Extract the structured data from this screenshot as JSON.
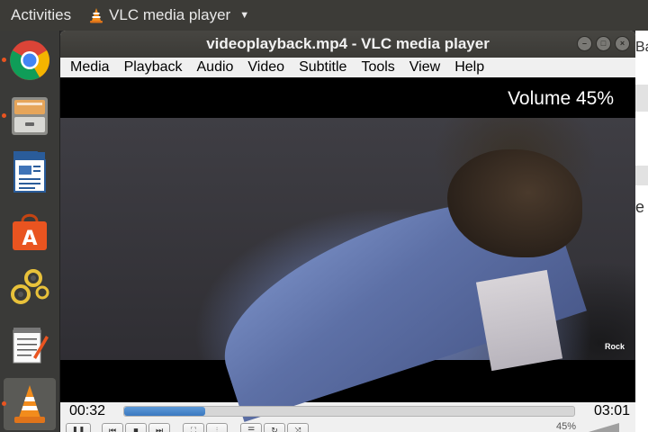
{
  "topbar": {
    "activities": "Activities",
    "app_name": "VLC media player",
    "app_icon": "vlc-cone-icon",
    "caret_icon": "caret-down-icon"
  },
  "dock": {
    "items": [
      {
        "name": "chrome",
        "icon": "chrome-icon",
        "running": true
      },
      {
        "name": "files",
        "icon": "file-cabinet-icon",
        "running": true
      },
      {
        "name": "writer",
        "icon": "document-writer-icon",
        "running": false
      },
      {
        "name": "software",
        "icon": "shopping-bag-icon",
        "running": false
      },
      {
        "name": "settings",
        "icon": "gears-icon",
        "running": false
      },
      {
        "name": "text-editor",
        "icon": "notepad-pencil-icon",
        "running": false
      },
      {
        "name": "vlc",
        "icon": "vlc-cone-icon",
        "running": true,
        "active": true
      }
    ]
  },
  "background_window": {
    "fragment_1": "Ba",
    "fragment_2": "e"
  },
  "vlc": {
    "title": "videoplayback.mp4 - VLC media player",
    "menu": [
      "Media",
      "Playback",
      "Audio",
      "Video",
      "Subtitle",
      "Tools",
      "View",
      "Help"
    ],
    "osd": "Volume 45%",
    "watermark": "Rock",
    "time_elapsed": "00:32",
    "time_total": "03:01",
    "progress_fraction": 0.18,
    "volume_label": "45%",
    "volume_fraction": 0.45,
    "colors": {
      "accent": "#3a78c0",
      "ubuntu_orange": "#e95420",
      "titlebar": "#3c3b37"
    }
  }
}
